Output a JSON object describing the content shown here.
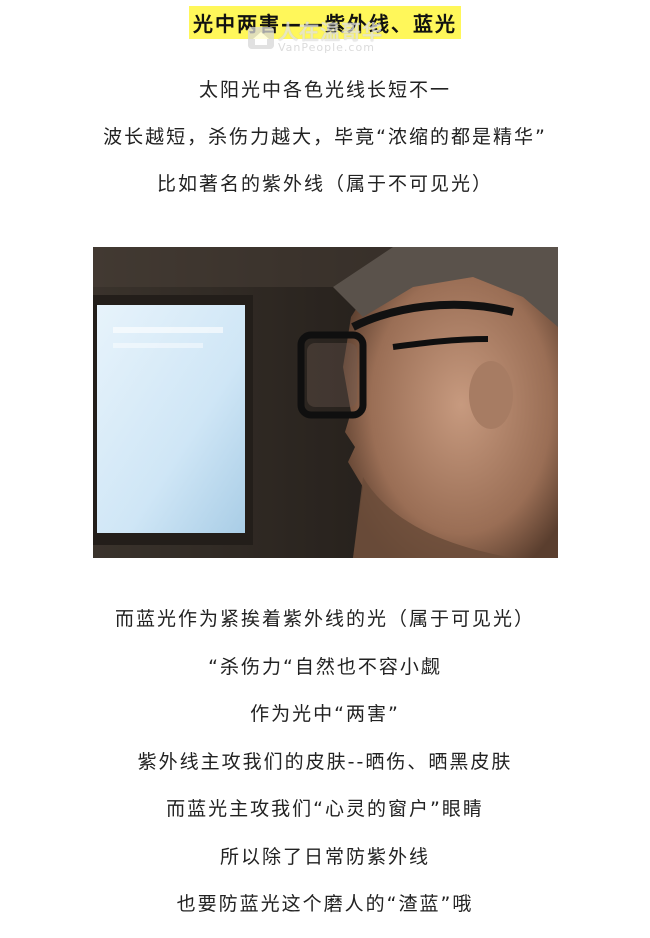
{
  "article": {
    "headline": "光中两害——紫外线、蓝光",
    "watermark": {
      "brand_cn": "人在温哥华",
      "brand_en": "VanPeople.com",
      "logo_icon": "house-icon"
    },
    "intro_lines": [
      "太阳光中各色光线长短不一",
      "波长越短，杀伤力越大，毕竟“浓缩的都是精华”",
      "比如著名的紫外线（属于不可见光）"
    ],
    "photo": {
      "subject": "man-with-glasses-looking-at-screen-image"
    },
    "body_lines": [
      "而蓝光作为紧挨着紫外线的光（属于可见光）",
      "“杀伤力“自然也不容小觑",
      "作为光中“两害”",
      "紫外线主攻我们的皮肤--晒伤、晒黑皮肤",
      "而蓝光主攻我们“心灵的窗户”眼睛",
      "所以除了日常防紫外线",
      "也要防蓝光这个磨人的“渣蓝”哦"
    ],
    "colors": {
      "highlight": "#fff75a",
      "text": "#222222",
      "background": "#ffffff"
    }
  }
}
